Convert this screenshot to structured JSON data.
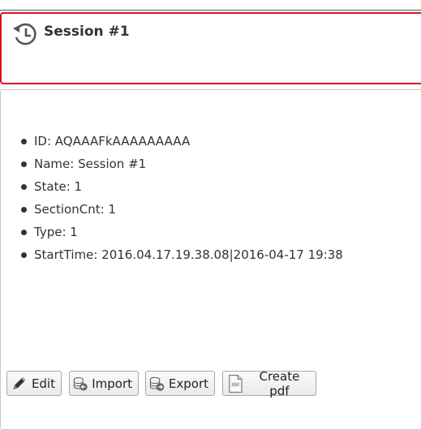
{
  "session": {
    "title": "Session #1",
    "icon": "history-clock-icon",
    "accent_color": "#d9131b"
  },
  "details": [
    {
      "text": "ID: AQAAAFkAAAAAAAAA"
    },
    {
      "text": "Name: Session #1"
    },
    {
      "text": "State: 1"
    },
    {
      "text": "SectionCnt: 1"
    },
    {
      "text": "Type: 1"
    },
    {
      "text": "StartTime: 2016.04.17.19.38.08|2016-04-17 19:38"
    }
  ],
  "buttons": {
    "edit": {
      "label": "Edit",
      "icon": "pencil-icon"
    },
    "import": {
      "label": "Import",
      "icon": "database-import-icon"
    },
    "export": {
      "label": "Export",
      "icon": "database-export-icon"
    },
    "pdf": {
      "label": "Create pdf",
      "icon": "pdf-file-icon"
    }
  }
}
